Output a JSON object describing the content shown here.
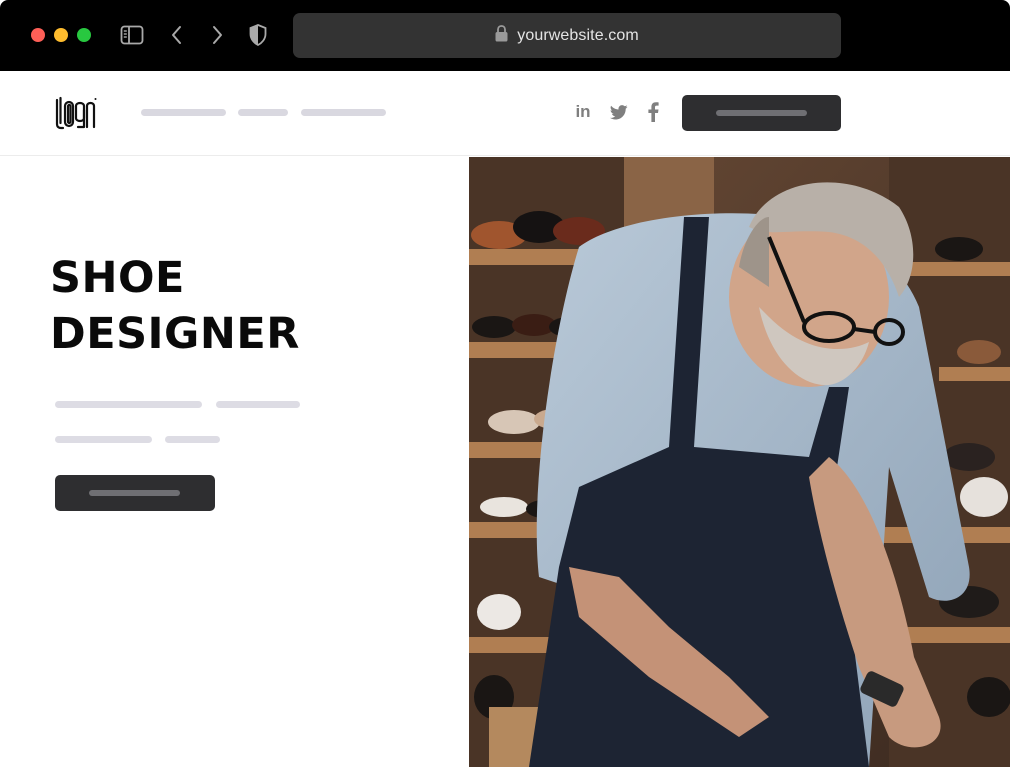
{
  "browser": {
    "url": "yourwebsite.com",
    "controls": [
      "close",
      "minimize",
      "maximize"
    ],
    "icons": [
      "sidebar-icon",
      "back-icon",
      "forward-icon",
      "shield-icon",
      "lock-icon"
    ]
  },
  "header": {
    "logo_text": "LOGO",
    "social": [
      "linkedin-icon",
      "twitter-icon",
      "facebook-icon"
    ],
    "social_in_label": "in"
  },
  "hero": {
    "title_line1": "SHOE",
    "title_line2": "DESIGNER"
  },
  "photo": {
    "subject": "older man in denim shirt and apron working in a shoe shop"
  },
  "colors": {
    "chrome_bg": "#000000",
    "urlbar_bg": "#333333",
    "button_bg": "#2e2e30",
    "placeholder_bar": "#dddce4",
    "title_text": "#0a0a0a"
  }
}
